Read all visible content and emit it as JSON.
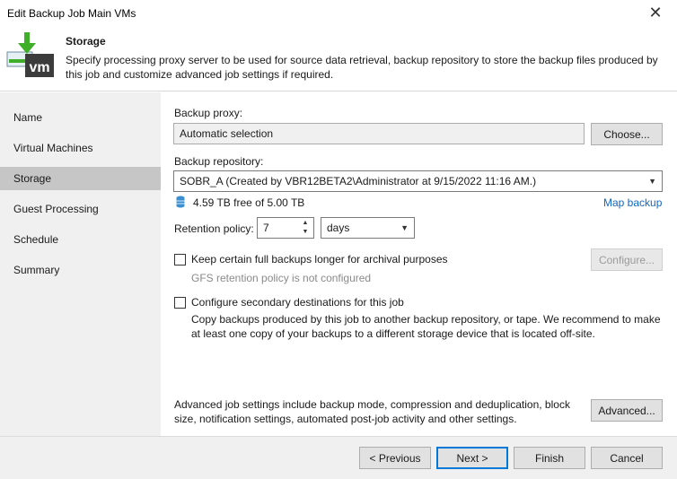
{
  "window": {
    "title": "Edit Backup Job Main VMs"
  },
  "header": {
    "title": "Storage",
    "description": "Specify processing proxy server to be used for source data retrieval, backup repository to store the backup files produced by this job and customize advanced job settings if required.",
    "logo_text": "vm"
  },
  "sidebar": {
    "items": [
      {
        "label": "Name"
      },
      {
        "label": "Virtual Machines"
      },
      {
        "label": "Storage"
      },
      {
        "label": "Guest Processing"
      },
      {
        "label": "Schedule"
      },
      {
        "label": "Summary"
      }
    ]
  },
  "proxy": {
    "label": "Backup proxy:",
    "value": "Automatic selection",
    "choose_label": "Choose..."
  },
  "repository": {
    "label": "Backup repository:",
    "value": "SOBR_A (Created by VBR12BETA2\\Administrator at 9/15/2022 11:16 AM.)",
    "free_space": "4.59 TB free of 5.00 TB",
    "map_label": "Map backup"
  },
  "retention": {
    "label": "Retention policy:",
    "value": "7",
    "unit": "days"
  },
  "gfs": {
    "checkbox_label": "Keep certain full backups longer for archival purposes",
    "status": "GFS retention policy is not configured",
    "configure_label": "Configure..."
  },
  "secondary": {
    "checkbox_label": "Configure secondary destinations for this job",
    "description": "Copy backups produced by this job to another backup repository, or tape. We recommend to make at least one copy of your backups to a different storage device that is located off-site."
  },
  "advanced": {
    "description": "Advanced job settings include backup mode, compression and deduplication, block size, notification settings, automated post-job activity and other settings.",
    "button_label": "Advanced..."
  },
  "footer": {
    "previous_label": "< Previous",
    "next_label": "Next >",
    "finish_label": "Finish",
    "cancel_label": "Cancel"
  },
  "colors": {
    "accent": "#0078d7",
    "link": "#1066c7",
    "logo_green": "#3fae29",
    "logo_dark": "#3c3c3c"
  }
}
